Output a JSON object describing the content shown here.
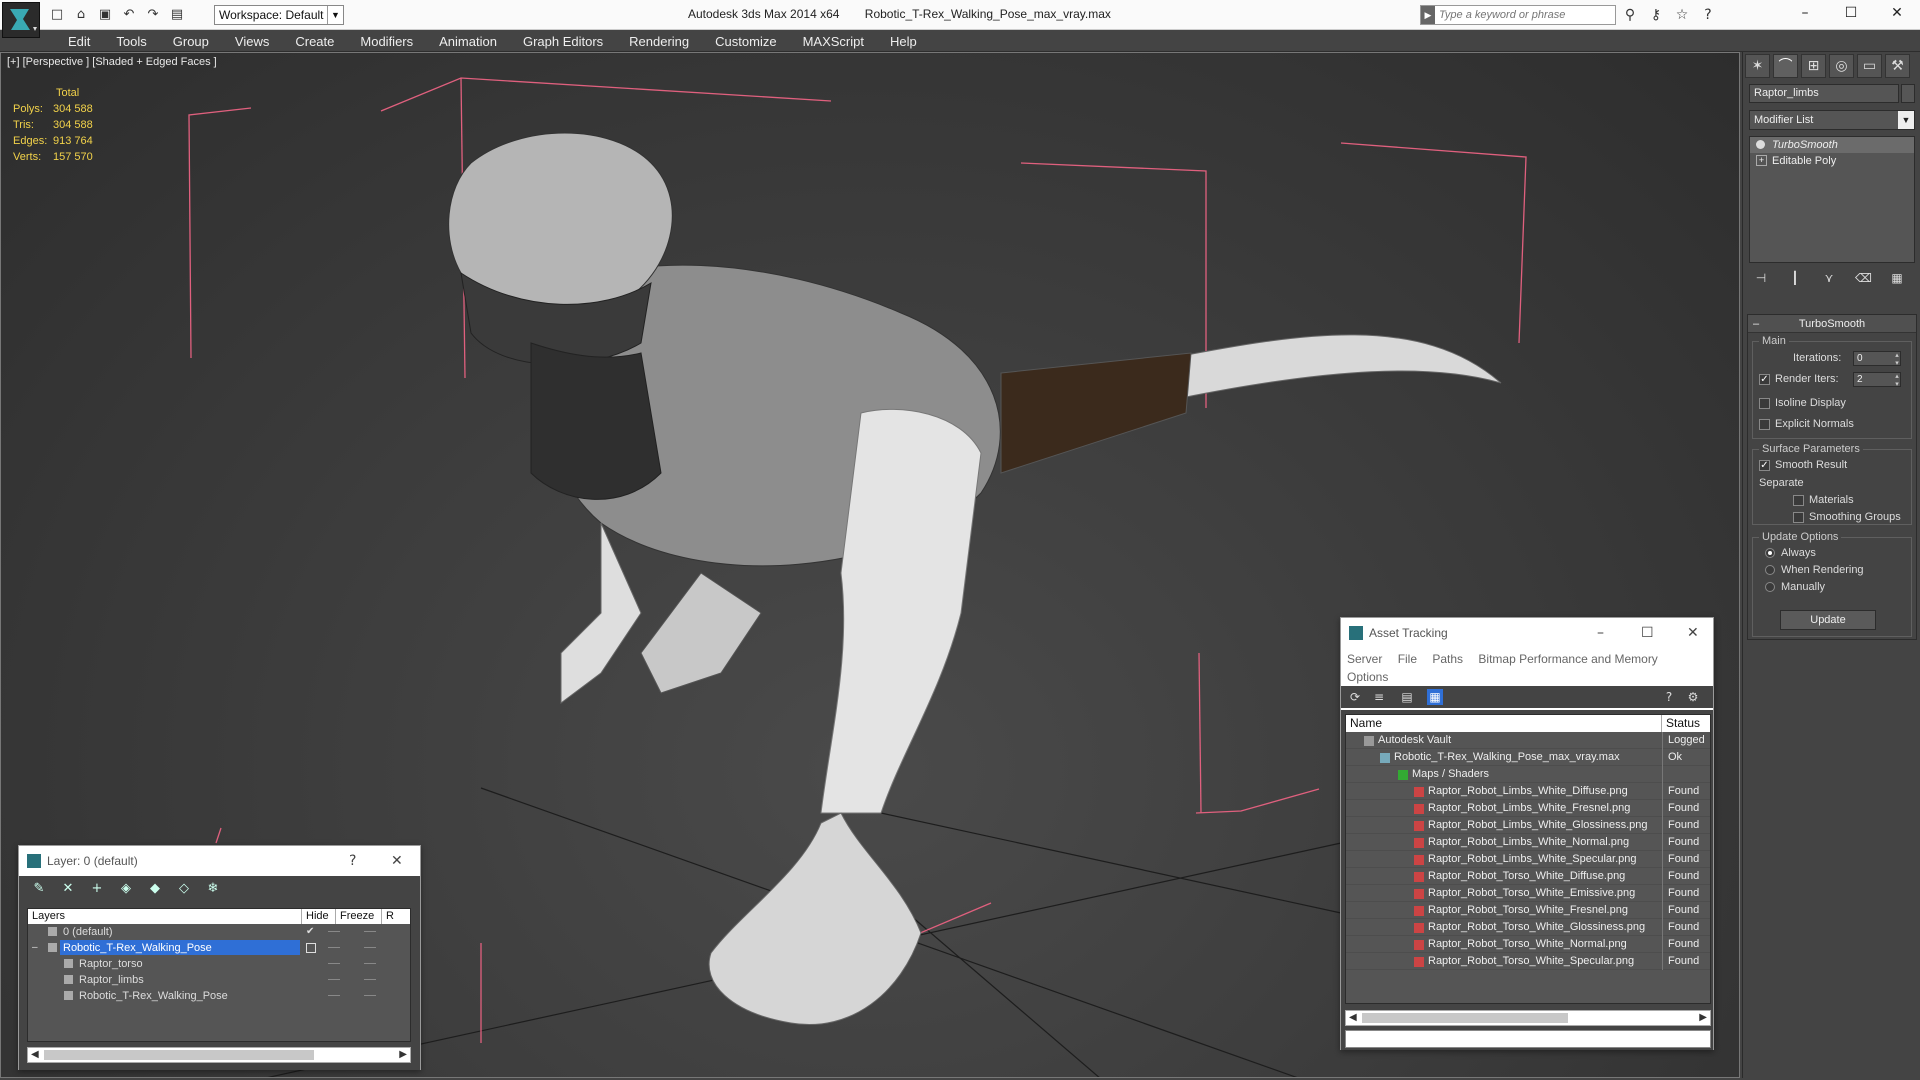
{
  "titlebar": {
    "workspace": "Workspace: Default",
    "app_name": "Autodesk 3ds Max 2014 x64",
    "file_name": "Robotic_T-Rex_Walking_Pose_max_vray.max",
    "search_placeholder": "Type a keyword or phrase"
  },
  "menu": [
    "Edit",
    "Tools",
    "Group",
    "Views",
    "Create",
    "Modifiers",
    "Animation",
    "Graph Editors",
    "Rendering",
    "Customize",
    "MAXScript",
    "Help"
  ],
  "viewport": {
    "label": "[+] [Perspective ] [Shaded + Edged Faces ]",
    "stats": {
      "header": "Total",
      "rows": [
        {
          "k": "Polys:",
          "v": "304 588"
        },
        {
          "k": "Tris:",
          "v": "304 588"
        },
        {
          "k": "Edges:",
          "v": "913 764"
        },
        {
          "k": "Verts:",
          "v": "157 570"
        }
      ]
    },
    "stat_color": "#f2d24a",
    "bbox_color": "#e0607e"
  },
  "command_panel": {
    "object_name": "Raptor_limbs",
    "modifier_list": "Modifier List",
    "stack": [
      "TurboSmooth",
      "Editable Poly"
    ],
    "rollout_title": "TurboSmooth",
    "main_label": "Main",
    "iterations_label": "Iterations:",
    "iterations_value": "0",
    "render_iters_label": "Render Iters:",
    "render_iters_value": "2",
    "isoline": "Isoline Display",
    "explicit_normals": "Explicit Normals",
    "surface_params": "Surface Parameters",
    "smooth_result": "Smooth Result",
    "separate": "Separate",
    "materials": "Materials",
    "smoothing_groups": "Smoothing Groups",
    "update_options": "Update Options",
    "always": "Always",
    "when_rendering": "When Rendering",
    "manually": "Manually",
    "update_button": "Update"
  },
  "layer_window": {
    "title": "Layer: 0 (default)",
    "columns": [
      "Layers",
      "Hide",
      "Freeze",
      "R"
    ],
    "rows": [
      "0 (default)",
      "Robotic_T-Rex_Walking_Pose",
      "Raptor_torso",
      "Raptor_limbs",
      "Robotic_T-Rex_Walking_Pose"
    ]
  },
  "asset_window": {
    "title": "Asset Tracking",
    "menu": [
      "Server",
      "File",
      "Paths",
      "Bitmap Performance and Memory",
      "Options"
    ],
    "columns": [
      "Name",
      "Status"
    ],
    "rows": [
      {
        "name": "Autodesk Vault",
        "status": "Logged"
      },
      {
        "name": "Robotic_T-Rex_Walking_Pose_max_vray.max",
        "status": "Ok"
      },
      {
        "name": "Maps / Shaders",
        "status": ""
      },
      {
        "name": "Raptor_Robot_Limbs_White_Diffuse.png",
        "status": "Found"
      },
      {
        "name": "Raptor_Robot_Limbs_White_Fresnel.png",
        "status": "Found"
      },
      {
        "name": "Raptor_Robot_Limbs_White_Glossiness.png",
        "status": "Found"
      },
      {
        "name": "Raptor_Robot_Limbs_White_Normal.png",
        "status": "Found"
      },
      {
        "name": "Raptor_Robot_Limbs_White_Specular.png",
        "status": "Found"
      },
      {
        "name": "Raptor_Robot_Torso_White_Diffuse.png",
        "status": "Found"
      },
      {
        "name": "Raptor_Robot_Torso_White_Emissive.png",
        "status": "Found"
      },
      {
        "name": "Raptor_Robot_Torso_White_Fresnel.png",
        "status": "Found"
      },
      {
        "name": "Raptor_Robot_Torso_White_Glossiness.png",
        "status": "Found"
      },
      {
        "name": "Raptor_Robot_Torso_White_Normal.png",
        "status": "Found"
      },
      {
        "name": "Raptor_Robot_Torso_White_Specular.png",
        "status": "Found"
      }
    ]
  }
}
